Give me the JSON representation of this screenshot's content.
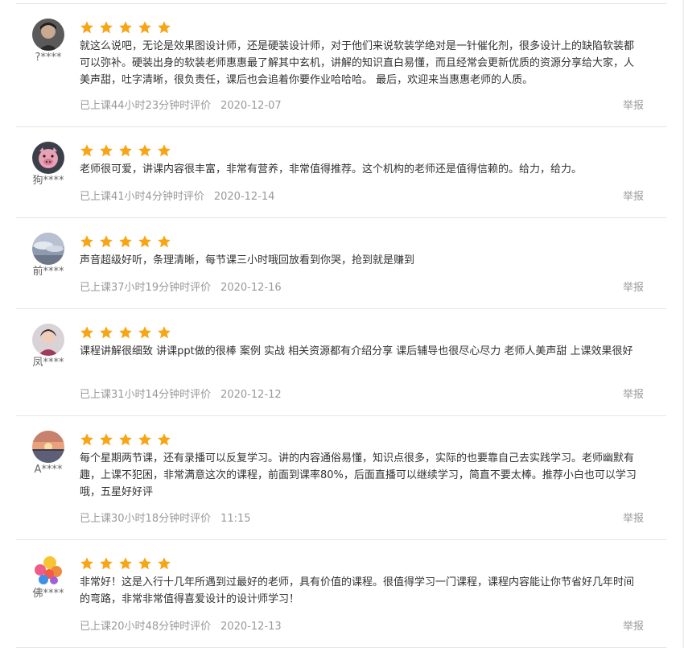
{
  "colors": {
    "star": "#f7a515",
    "meta": "#999999",
    "divider": "#e5e5e5"
  },
  "reviews": [
    {
      "author": "?****",
      "avatar_icon": "dark-portrait-avatar-icon",
      "rating": 5,
      "comment": "就这么说吧，无论是效果图设计师，还是硬装设计师，对于他们来说软装学绝对是一针催化剂，很多设计上的缺陷软装都可以弥补。硬装出身的软装老师惠惠最了解其中玄机，讲解的知识直白易懂，而且经常会更新优质的资源分享给大家，人美声甜，吐字清晰，很负责任，课后也会追着你要作业哈哈哈。 最后，欢迎来当惠惠老师的人质。",
      "study_time": "已上课44小时23分钟时评价",
      "date": "2020-12-07",
      "report": "举报"
    },
    {
      "author": "狗****",
      "avatar_icon": "pig-avatar-icon",
      "rating": 5,
      "comment": "老师很可爱，讲课内容很丰富，非常有营养，非常值得推荐。这个机构的老师还是值得信赖的。给力，给力。",
      "study_time": "已上课41小时4分钟时评价",
      "date": "2020-12-14",
      "report": "举报"
    },
    {
      "author": "前****",
      "avatar_icon": "cloudy-sky-avatar-icon",
      "rating": 5,
      "comment": "声音超级好听，条理清晰，每节课三小时哦回放看到你哭，抢到就是赚到",
      "study_time": "已上课37小时19分钟时评价",
      "date": "2020-12-16",
      "report": "举报"
    },
    {
      "author": "凤****",
      "avatar_icon": "portrait-avatar-icon",
      "rating": 5,
      "comment": "课程讲解很细致 讲课ppt做的很棒 案例 实战 相关资源都有介绍分享 课后辅导也很尽心尽力 老师人美声甜 上课效果很好",
      "study_time": "已上课31小时14分钟时评价",
      "date": "2020-12-12",
      "report": "举报"
    },
    {
      "author": "A****",
      "avatar_icon": "sunset-avatar-icon",
      "rating": 5,
      "comment": "每个星期两节课，还有录播可以反复学习。讲的内容通俗易懂，知识点很多，实际的也要靠自己去实践学习。老师幽默有趣，上课不犯困，非常满意这次的课程，前面到课率80%，后面直播可以继续学习，简直不要太棒。推荐小白也可以学习哦，五星好好评",
      "study_time": "已上课30小时18分钟时评价",
      "date": "11:15",
      "report": "举报"
    },
    {
      "author": "佛****",
      "avatar_icon": "colorful-circles-avatar-icon",
      "rating": 5,
      "comment": "非常好！这是入行十几年所遇到过最好的老师，具有价值的课程。很值得学习一门课程，课程内容能让你节省好几年时间的弯路，非常非常值得喜爱设计的设计师学习！",
      "study_time": "已上课20小时48分钟时评价",
      "date": "2020-12-13",
      "report": "举报"
    }
  ]
}
